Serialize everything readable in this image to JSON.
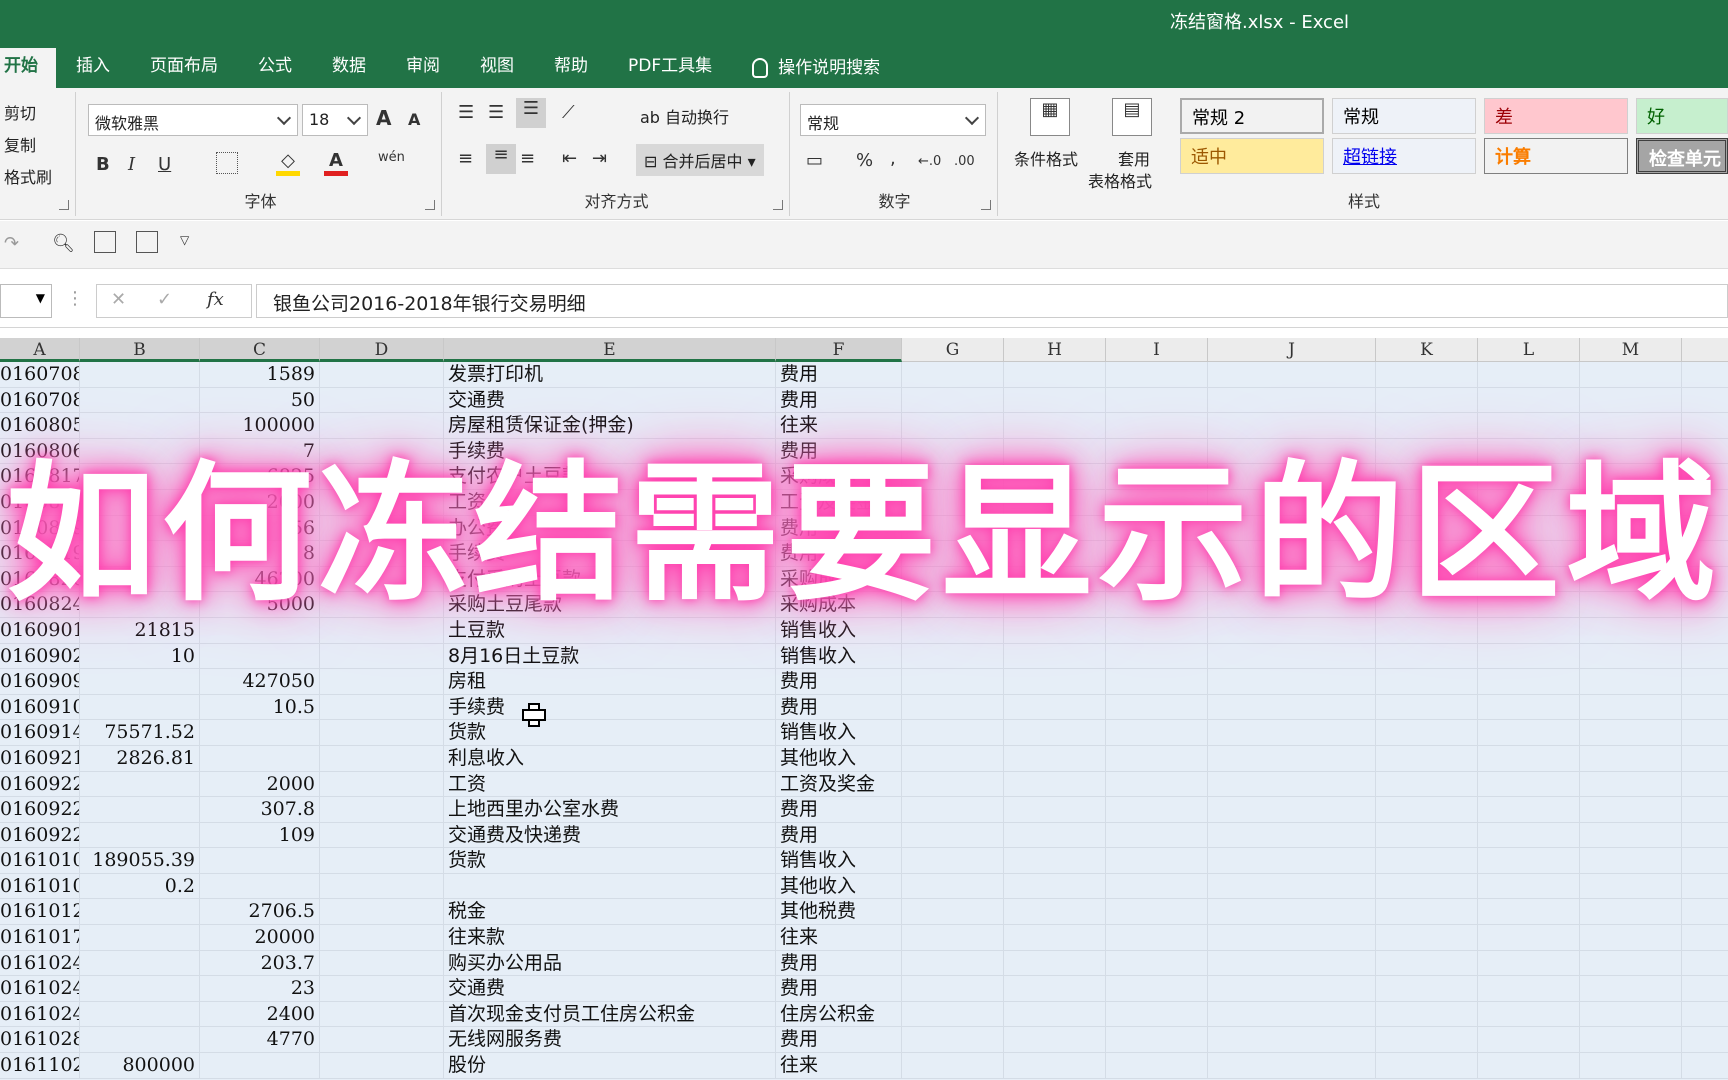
{
  "window": {
    "title": "冻结窗格.xlsx  -  Excel"
  },
  "tabs": [
    "开始",
    "插入",
    "页面布局",
    "公式",
    "数据",
    "审阅",
    "视图",
    "帮助",
    "PDF工具集"
  ],
  "tell_me": "操作说明搜索",
  "clipboard": {
    "cut": "剪切",
    "copy": "复制",
    "format_painter": "格式刷"
  },
  "font": {
    "name": "微软雅黑",
    "size": "18",
    "label": "字体",
    "grow": "A",
    "shrink": "A",
    "bold": "B",
    "italic": "I",
    "underline": "U",
    "color": "A",
    "phonetic": "wén"
  },
  "alignment": {
    "wrap": "自动换行",
    "merge": "合并后居中",
    "label": "对齐方式"
  },
  "number": {
    "format": "常规",
    "percent": "%",
    "comma": ",",
    "inc_decimal": "←.0",
    "dec_decimal": ".00",
    "label": "数字"
  },
  "styles": {
    "conditional": "条件格式",
    "table_line1": "套用",
    "table_line2": "表格格式",
    "label": "样式",
    "cells": [
      "常规 2",
      "常规",
      "差",
      "好",
      "适中",
      "超链接",
      "计算",
      "检查单元"
    ]
  },
  "formula": {
    "content": "银鱼公司2016-2018年银行交易明细",
    "fx": "fx",
    "cancel": "✕",
    "enter": "✓"
  },
  "columns": [
    "A",
    "B",
    "C",
    "D",
    "E",
    "F",
    "G",
    "H",
    "I",
    "J",
    "K",
    "L",
    "M"
  ],
  "rows": [
    {
      "a": "0160708",
      "b": "",
      "c": "1589",
      "e": "发票打印机",
      "f": "费用"
    },
    {
      "a": "0160708",
      "b": "",
      "c": "50",
      "e": "交通费",
      "f": "费用"
    },
    {
      "a": "0160805",
      "b": "",
      "c": "100000",
      "e": "房屋租赁保证金(押金)",
      "f": "往来"
    },
    {
      "a": "0160806",
      "b": "",
      "c": "7",
      "e": "手续费",
      "f": "费用"
    },
    {
      "a": "0160817",
      "b": "",
      "c": "6825",
      "e": "支付农户土豆款",
      "f": "采购成本"
    },
    {
      "a": "0160819",
      "b": "",
      "c": "2000",
      "e": "工资",
      "f": "工资及奖金"
    },
    {
      "a": "0160819",
      "b": "",
      "c": "56",
      "e": "办公费",
      "f": "费用"
    },
    {
      "a": "0160819",
      "b": "",
      "c": "8",
      "e": "手续费",
      "f": "费用"
    },
    {
      "a": "0160820",
      "b": "",
      "c": "46200",
      "e": "支付采购土豆款",
      "f": "采购成本"
    },
    {
      "a": "0160824",
      "b": "",
      "c": "5000",
      "e": "采购土豆尾款",
      "f": "采购成本"
    },
    {
      "a": "0160901",
      "b": "21815",
      "c": "",
      "e": "土豆款",
      "f": "销售收入"
    },
    {
      "a": "0160902",
      "b": "10",
      "c": "",
      "e": "8月16日土豆款",
      "f": "销售收入"
    },
    {
      "a": "0160909",
      "b": "",
      "c": "427050",
      "e": "房租",
      "f": "费用"
    },
    {
      "a": "0160910",
      "b": "",
      "c": "10.5",
      "e": "手续费",
      "f": "费用"
    },
    {
      "a": "0160914",
      "b": "75571.52",
      "c": "",
      "e": "货款",
      "f": "销售收入"
    },
    {
      "a": "0160921",
      "b": "2826.81",
      "c": "",
      "e": "利息收入",
      "f": "其他收入"
    },
    {
      "a": "0160922",
      "b": "",
      "c": "2000",
      "e": "工资",
      "f": "工资及奖金"
    },
    {
      "a": "0160922",
      "b": "",
      "c": "307.8",
      "e": "上地西里办公室水费",
      "f": "费用"
    },
    {
      "a": "0160922",
      "b": "",
      "c": "109",
      "e": "交通费及快递费",
      "f": "费用"
    },
    {
      "a": "0161010",
      "b": "189055.39",
      "c": "",
      "e": "货款",
      "f": "销售收入"
    },
    {
      "a": "0161010",
      "b": "0.2",
      "c": "",
      "e": "",
      "f": "其他收入"
    },
    {
      "a": "0161012",
      "b": "",
      "c": "2706.5",
      "e": "税金",
      "f": "其他税费"
    },
    {
      "a": "0161017",
      "b": "",
      "c": "20000",
      "e": "往来款",
      "f": "往来"
    },
    {
      "a": "0161024",
      "b": "",
      "c": "203.7",
      "e": "购买办公用品",
      "f": "费用"
    },
    {
      "a": "0161024",
      "b": "",
      "c": "23",
      "e": "交通费",
      "f": "费用"
    },
    {
      "a": "0161024",
      "b": "",
      "c": "2400",
      "e": "首次现金支付员工住房公积金",
      "f": "住房公积金"
    },
    {
      "a": "0161028",
      "b": "",
      "c": "4770",
      "e": "无线网服务费",
      "f": "费用"
    },
    {
      "a": "0161102",
      "b": "800000",
      "c": "",
      "e": "股份",
      "f": "往来"
    }
  ],
  "overlay_text": "如何冻结需要显示的区域"
}
